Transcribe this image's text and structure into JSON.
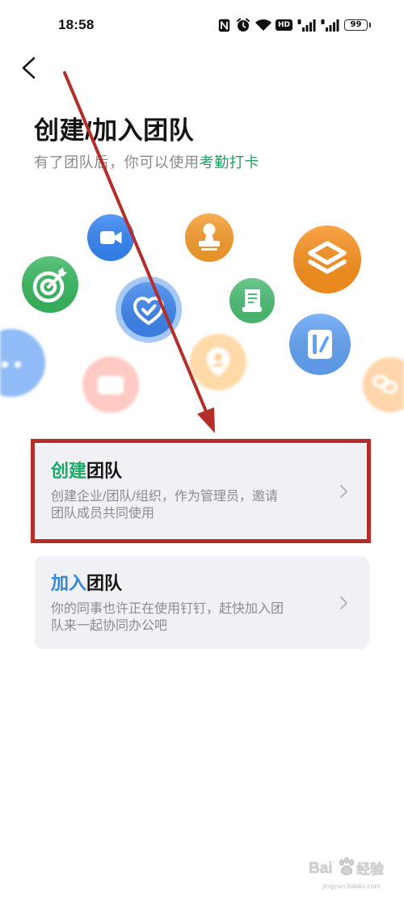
{
  "status_bar": {
    "time": "18:58",
    "hd_label": "HD",
    "battery_level": "99",
    "icons": [
      "nfc-icon",
      "alarm-icon",
      "wifi-icon",
      "hd-icon",
      "signal-icon",
      "signal-icon",
      "battery-icon"
    ]
  },
  "header": {
    "back_icon": "chevron-left-icon",
    "title": "创建/加入团队",
    "subtitle": "有了团队后，你可以使用",
    "subtitle_highlight": "考勤打卡",
    "highlight_color": "#1f9f5f"
  },
  "illustration": {
    "icons": [
      {
        "name": "video-camera-icon",
        "color": "#3584f5"
      },
      {
        "name": "stamp-icon",
        "color": "#f59c2c"
      },
      {
        "name": "layers-icon",
        "color": "#f8901e"
      },
      {
        "name": "target-icon",
        "color": "#37b85f"
      },
      {
        "name": "heart-check-icon",
        "color": "#3d85ee",
        "ring_color": "#a6c8f7"
      },
      {
        "name": "document-icon",
        "color": "#4cbd74"
      },
      {
        "name": "chat-icon",
        "color": "#90bbf6"
      },
      {
        "name": "location-icon",
        "color": "#ffd9a8"
      },
      {
        "name": "notebook-icon",
        "color": "#62a2f4"
      },
      {
        "name": "card-icon",
        "color": "#ffcac3"
      },
      {
        "name": "link-icon",
        "color": "#ffd5ab"
      }
    ]
  },
  "options": [
    {
      "title_accent": "创建",
      "title_rest": "团队",
      "accent_color": "#18ab67",
      "description": "创建企业/团队/组织，作为管理员，邀请团队成员共同使用",
      "icon": "chevron-right-icon"
    },
    {
      "title_accent": "加入",
      "title_rest": "团队",
      "accent_color": "#2f87da",
      "description": "你的同事也许正在使用钉钉，赶快加入团队来一起协同办公吧",
      "icon": "chevron-right-icon"
    }
  ],
  "annotation": {
    "color": "#b42d29"
  },
  "watermark": {
    "brand": "Bai",
    "product": "经验",
    "url": "jingyan.baidu.com"
  }
}
